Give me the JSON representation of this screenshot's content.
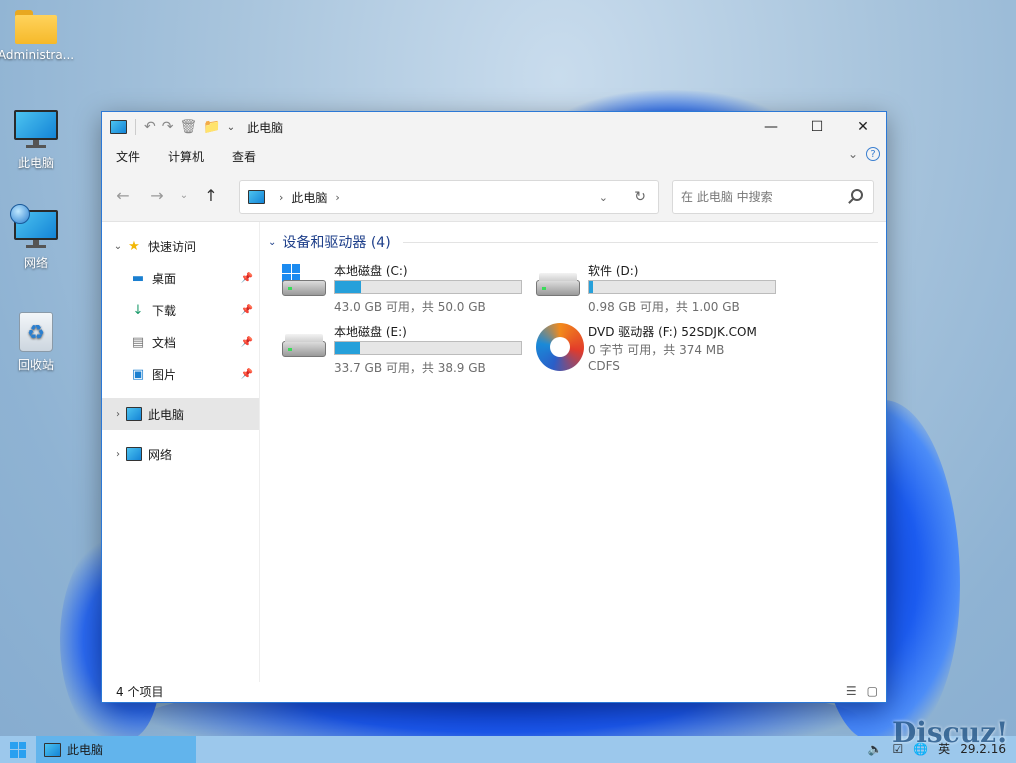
{
  "desktop": {
    "icons": [
      {
        "label": "Administra..."
      },
      {
        "label": "此电脑"
      },
      {
        "label": "网络"
      },
      {
        "label": "回收站"
      }
    ]
  },
  "window": {
    "title": "此电脑",
    "ribbon_tabs": [
      "文件",
      "计算机",
      "查看"
    ],
    "address": {
      "location": "此电脑"
    },
    "search": {
      "placeholder": "在 此电脑 中搜索"
    },
    "sidebar": {
      "quick_access": "快速访问",
      "items": [
        {
          "label": "桌面",
          "icon": "desktop-icon"
        },
        {
          "label": "下载",
          "icon": "download-icon"
        },
        {
          "label": "文档",
          "icon": "document-icon"
        },
        {
          "label": "图片",
          "icon": "picture-icon"
        }
      ],
      "this_pc": "此电脑",
      "network": "网络"
    },
    "group": {
      "title": "设备和驱动器 (4)"
    },
    "drives": [
      {
        "name": "本地磁盘 (C:)",
        "detail": "43.0 GB 可用，共 50.0 GB",
        "used_fraction": 0.14
      },
      {
        "name": "软件 (D:)",
        "detail": "0.98 GB 可用，共 1.00 GB",
        "used_fraction": 0.02
      },
      {
        "name": "本地磁盘 (E:)",
        "detail": "33.7 GB 可用，共 38.9 GB",
        "used_fraction": 0.134
      },
      {
        "name": "DVD 驱动器 (F:) 52SDJK.COM",
        "detail": "0 字节 可用，共 374 MB",
        "fs": "CDFS"
      }
    ],
    "status": "4 个项目"
  },
  "taskbar": {
    "item": "此电脑",
    "clock": "29.2.16"
  },
  "watermark": "Discuz!"
}
